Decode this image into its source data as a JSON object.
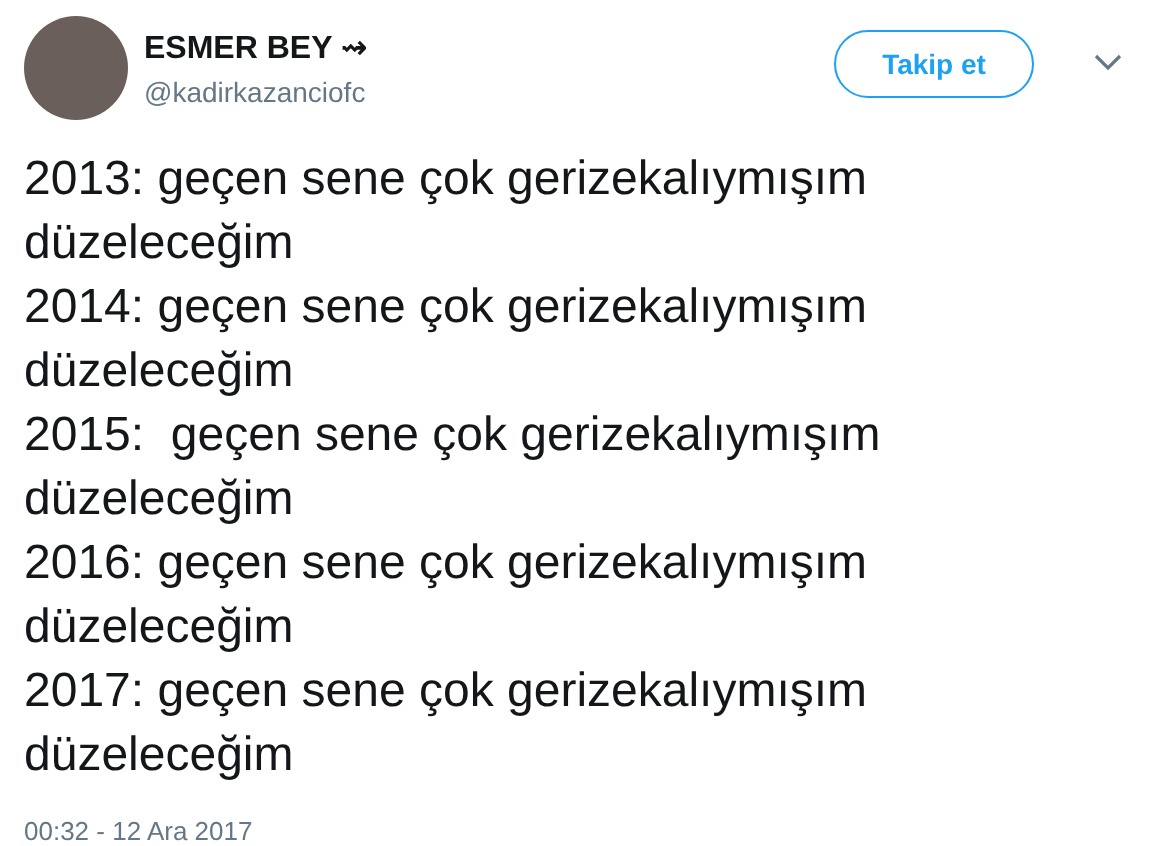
{
  "author": {
    "name": "ESMER BEY ⇝",
    "handle": "@kadirkazanciofc"
  },
  "follow_button": "Takip et",
  "tweet_lines": [
    "2013: geçen sene çok gerizekalıymışım düzeleceğim",
    "2014: geçen sene çok gerizekalıymışım düzeleceğim",
    "2015:  geçen sene çok gerizekalıymışım düzeleceğim",
    "2016: geçen sene çok gerizekalıymışım düzeleceğim",
    "2017: geçen sene çok gerizekalıymışım düzeleceğim"
  ],
  "timestamp": "00:32 - 12 Ara 2017"
}
